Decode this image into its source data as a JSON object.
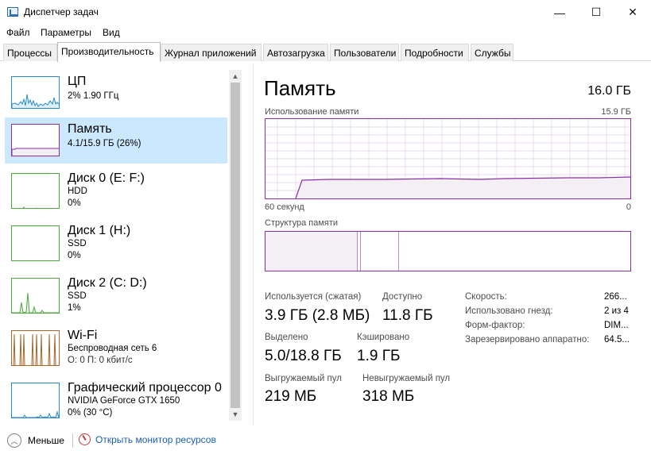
{
  "window": {
    "title": "Диспетчер задач",
    "minimize_glyph": "—",
    "maximize_glyph": "☐",
    "close_glyph": "✕"
  },
  "menu": {
    "items": [
      "Файл",
      "Параметры",
      "Вид"
    ]
  },
  "tabs": [
    {
      "label": "Процессы",
      "active": false
    },
    {
      "label": "Производительность",
      "active": true
    },
    {
      "label": "Журнал приложений",
      "active": false
    },
    {
      "label": "Автозагрузка",
      "active": false
    },
    {
      "label": "Пользователи",
      "active": false
    },
    {
      "label": "Подробности",
      "active": false
    },
    {
      "label": "Службы",
      "active": false
    }
  ],
  "sidebar": {
    "items": [
      {
        "name": "ЦП",
        "line1": "2% 1.90 ГГц",
        "line2": "",
        "color": "#2a8ac8",
        "selected": false
      },
      {
        "name": "Память",
        "line1": "4.1/15.9 ГБ (26%)",
        "line2": "",
        "color": "#8b2fa6",
        "selected": true
      },
      {
        "name": "Диск 0 (E: F:)",
        "line1": "HDD",
        "line2": "0%",
        "color": "#4da83e",
        "selected": false
      },
      {
        "name": "Диск 1 (H:)",
        "line1": "SSD",
        "line2": "0%",
        "color": "#4da83e",
        "selected": false
      },
      {
        "name": "Диск 2 (C: D:)",
        "line1": "SSD",
        "line2": "1%",
        "color": "#4da83e",
        "selected": false
      },
      {
        "name": "Wi-Fi",
        "line1": "Беспроводная сеть 6",
        "line2": "О: 0 П: 0 кбит/с",
        "color": "#a7652b",
        "selected": false
      },
      {
        "name": "Графический процессор 0",
        "line1": "NVIDIA GeForce GTX 1650",
        "line2": "0% (30 °C)",
        "color": "#2a8ac8",
        "selected": false
      }
    ]
  },
  "main": {
    "title": "Память",
    "total": "16.0 ГБ",
    "usage_graph": {
      "label": "Использование памяти",
      "max_label": "15.9 ГБ",
      "x_left_label": "60 секунд",
      "x_right_label": "0",
      "line_color": "#8b2fa6",
      "fill_color": "#f4eef5"
    },
    "composition": {
      "label": "Структура памяти"
    },
    "stats": {
      "in_use_label": "Используется (сжатая)",
      "in_use_value": "3.9 ГБ (2.8 МБ)",
      "available_label": "Доступно",
      "available_value": "11.8 ГБ",
      "committed_label": "Выделено",
      "committed_value": "5.0/18.8 ГБ",
      "cached_label": "Кэшировано",
      "cached_value": "1.9 ГБ",
      "paged_label": "Выгружаемый пул",
      "paged_value": "219 МБ",
      "nonpaged_label": "Невыгружаемый пул",
      "nonpaged_value": "318 МБ"
    },
    "details": [
      {
        "label": "Скорость:",
        "value": "266..."
      },
      {
        "label": "Использовано гнезд:",
        "value": "2 из 4"
      },
      {
        "label": "Форм-фактор:",
        "value": "DIM..."
      },
      {
        "label": "Зарезервировано аппаратно:",
        "value": "64.5..."
      }
    ]
  },
  "footer": {
    "less_label": "Меньше",
    "resmon_label": "Открыть монитор ресурсов"
  }
}
